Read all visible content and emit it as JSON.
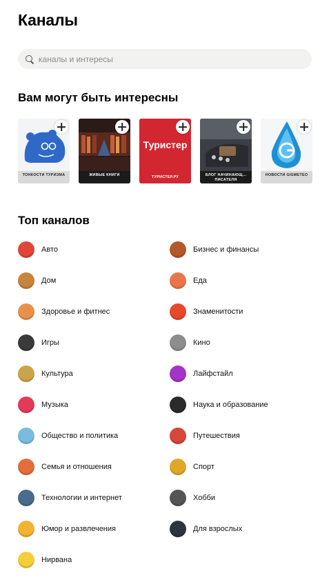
{
  "header": {
    "title": "Каналы"
  },
  "search": {
    "placeholder": "каналы и интересы"
  },
  "recommended": {
    "title": "Вам могут быть интересны",
    "cards": [
      {
        "label": "ТОНКОСТИ ТУРИЗМА",
        "icon": "polar-bear-logo"
      },
      {
        "label": "ЖИВЫЕ КНИГИ",
        "icon": "library-photo"
      },
      {
        "label": "ТУРИСТЕР.РУ",
        "logo_text": "Туристер",
        "icon": "turister-logo"
      },
      {
        "label": "БЛОГ НАЧИНАЮЩ... ПИСАТЕЛЯ",
        "icon": "typewriter-photo"
      },
      {
        "label": "НОВОСТИ GISMETEO",
        "icon": "water-drop-logo"
      }
    ]
  },
  "top": {
    "title": "Топ каналов",
    "categories": [
      {
        "label": "Авто",
        "icon": "car-icon",
        "color": "#e0453a"
      },
      {
        "label": "Бизнес и финансы",
        "icon": "briefcase-icon",
        "color": "#b5582a"
      },
      {
        "label": "Дом",
        "icon": "house-icon",
        "color": "#c8843c"
      },
      {
        "label": "Еда",
        "icon": "food-icon",
        "color": "#e9764a"
      },
      {
        "label": "Здоровье и фитнес",
        "icon": "runner-icon",
        "color": "#e8914d"
      },
      {
        "label": "Знаменитости",
        "icon": "celebrity-icon",
        "color": "#e64a2a"
      },
      {
        "label": "Игры",
        "icon": "gamepad-icon",
        "color": "#3a3a3a"
      },
      {
        "label": "Кино",
        "icon": "film-reel-icon",
        "color": "#8d8d8d"
      },
      {
        "label": "Культура",
        "icon": "museum-icon",
        "color": "#c9a449"
      },
      {
        "label": "Лайфстайл",
        "icon": "sunglasses-icon",
        "color": "#a533c9"
      },
      {
        "label": "Музыка",
        "icon": "music-note-icon",
        "color": "#e33a5a"
      },
      {
        "label": "Наука и образование",
        "icon": "graduation-cap-icon",
        "color": "#2b2b2b"
      },
      {
        "label": "Общество и политика",
        "icon": "globe-icon",
        "color": "#7bbbe0"
      },
      {
        "label": "Путешествия",
        "icon": "passport-icon",
        "color": "#d9463a"
      },
      {
        "label": "Семья и отношения",
        "icon": "family-icon",
        "color": "#e46d3d"
      },
      {
        "label": "Спорт",
        "icon": "trophy-icon",
        "color": "#e0a82b"
      },
      {
        "label": "Технологии и интернет",
        "icon": "laptop-icon",
        "color": "#4a6b8a"
      },
      {
        "label": "Хобби",
        "icon": "camera-icon",
        "color": "#555555"
      },
      {
        "label": "Юмор и развлечения",
        "icon": "laughing-face-icon",
        "color": "#f2b233"
      },
      {
        "label": "Для взрослых",
        "icon": "dark-moon-icon",
        "color": "#2d3440"
      },
      {
        "label": "Нирвана",
        "icon": "sun-icon",
        "color": "#f5cf3a"
      }
    ]
  }
}
